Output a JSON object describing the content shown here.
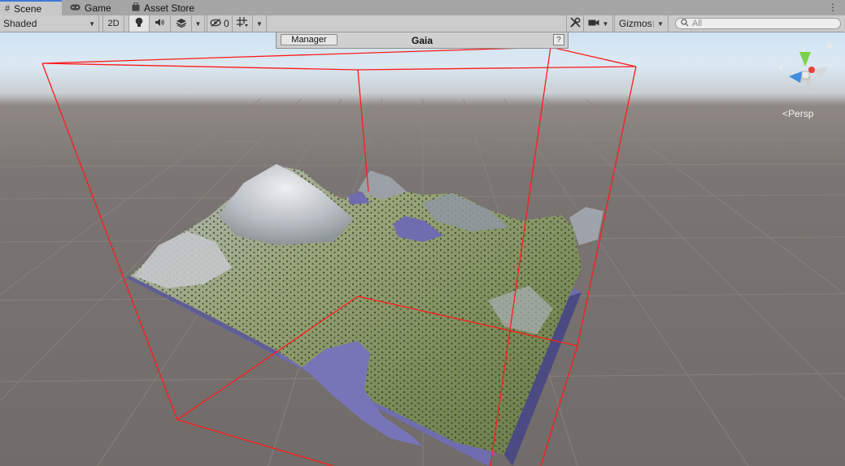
{
  "tabs": [
    {
      "label": "Scene",
      "icon": "grid-icon",
      "active": true
    },
    {
      "label": "Game",
      "icon": "gamepad-icon",
      "active": false
    },
    {
      "label": "Asset Store",
      "icon": "shopping-bag-icon",
      "active": false
    }
  ],
  "toolbar": {
    "shading_mode": "Shaded",
    "mode_2d_label": "2D",
    "hidden_count": "0",
    "gizmos_label": "Gizmos",
    "search_placeholder": "All"
  },
  "gaia_panel": {
    "manager_button": "Manager",
    "title": "Gaia",
    "help_label": "?"
  },
  "gizmo": {
    "y_axis_label": "y",
    "x_axis_label": "x",
    "projection_label": "Persp",
    "colors": {
      "x": "#e6403a",
      "y": "#7cd14a",
      "z": "#3f8de0"
    }
  },
  "colors": {
    "bounds_box": "#ff1b1b",
    "water": "#6f6db0",
    "tab_accent": "#3a79d8"
  }
}
